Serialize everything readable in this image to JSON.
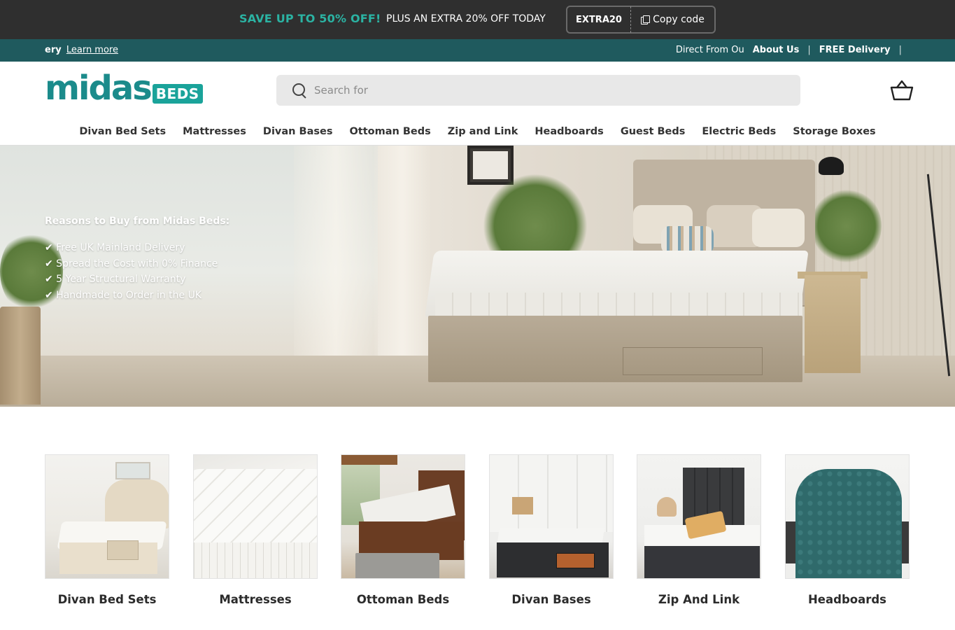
{
  "promo": {
    "headline": "SAVE UP TO 50% OFF!",
    "subline": "PLUS AN EXTRA 20% OFF TODAY",
    "code": "EXTRA20",
    "copy_label": "Copy code",
    "accent": "#2bb3a3",
    "background": "#2f2f2f"
  },
  "infobar": {
    "left_bold": "ery",
    "left_link": "Learn more",
    "right_text": "Direct From Ou",
    "right_link_1": "About Us",
    "right_link_2": "FREE Delivery",
    "separator": "|",
    "background": "#1f5a5e"
  },
  "header": {
    "logo_word": "midas",
    "logo_badge": "BEDS",
    "search_placeholder": "Search for",
    "basket_icon": "basket-icon"
  },
  "nav": {
    "items": [
      "Divan Bed Sets",
      "Mattresses",
      "Divan Bases",
      "Ottoman Beds",
      "Zip and Link",
      "Headboards",
      "Guest Beds",
      "Electric Beds",
      "Storage Boxes"
    ]
  },
  "hero": {
    "title": "Reasons to Buy from Midas Beds:",
    "bullets": [
      "✔ Free UK Mainland Delivery",
      "✔ Spread the Cost with 0% Finance",
      "✔ 5 Year Structural Warranty",
      "✔ Handmade to Order in the UK"
    ]
  },
  "categories": [
    {
      "label": "Divan Bed Sets"
    },
    {
      "label": "Mattresses"
    },
    {
      "label": "Ottoman Beds"
    },
    {
      "label": "Divan Bases"
    },
    {
      "label": "Zip And Link"
    },
    {
      "label": "Headboards"
    }
  ]
}
